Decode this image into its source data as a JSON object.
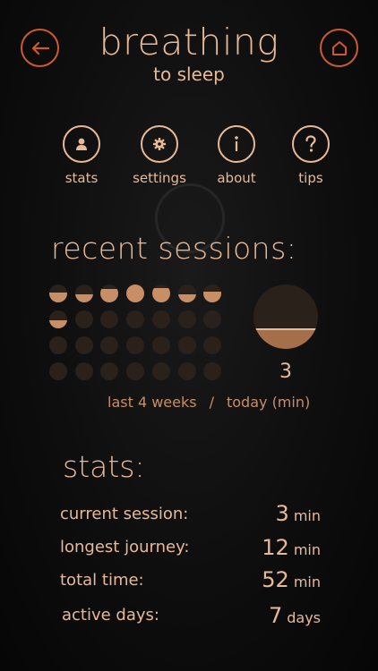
{
  "header": {
    "title": "breathing",
    "subtitle": "to sleep",
    "accent_color": "#cd5a2d",
    "text_color": "#e8b996"
  },
  "nav": {
    "items": [
      {
        "label": "stats",
        "icon": "user-icon"
      },
      {
        "label": "settings",
        "icon": "gear-icon"
      },
      {
        "label": "about",
        "icon": "info-icon"
      },
      {
        "label": "tips",
        "icon": "question-icon"
      }
    ]
  },
  "recent": {
    "title": "recent sessions:",
    "grid_fill_levels": [
      [
        0.55,
        0.45,
        0.75,
        1.0,
        0.8,
        0.45,
        0.6
      ],
      [
        0.45,
        0,
        0,
        0,
        0,
        0,
        0
      ],
      [
        0,
        0,
        0,
        0,
        0,
        0,
        0
      ],
      [
        0,
        0,
        0,
        0,
        0,
        0,
        0
      ]
    ],
    "today_fill_level": 0.3,
    "today_value": "3",
    "caption_left": "last 4 weeks",
    "caption_sep": "/",
    "caption_right": "today (min)"
  },
  "stats": {
    "title": "stats:",
    "rows": [
      {
        "label": "current session:",
        "value": "3",
        "unit": "min"
      },
      {
        "label": "longest journey:",
        "value": "12",
        "unit": "min"
      },
      {
        "label": "total time:",
        "value": "52",
        "unit": "min"
      },
      {
        "label": "active days:",
        "value": "7",
        "unit": "days"
      }
    ]
  }
}
